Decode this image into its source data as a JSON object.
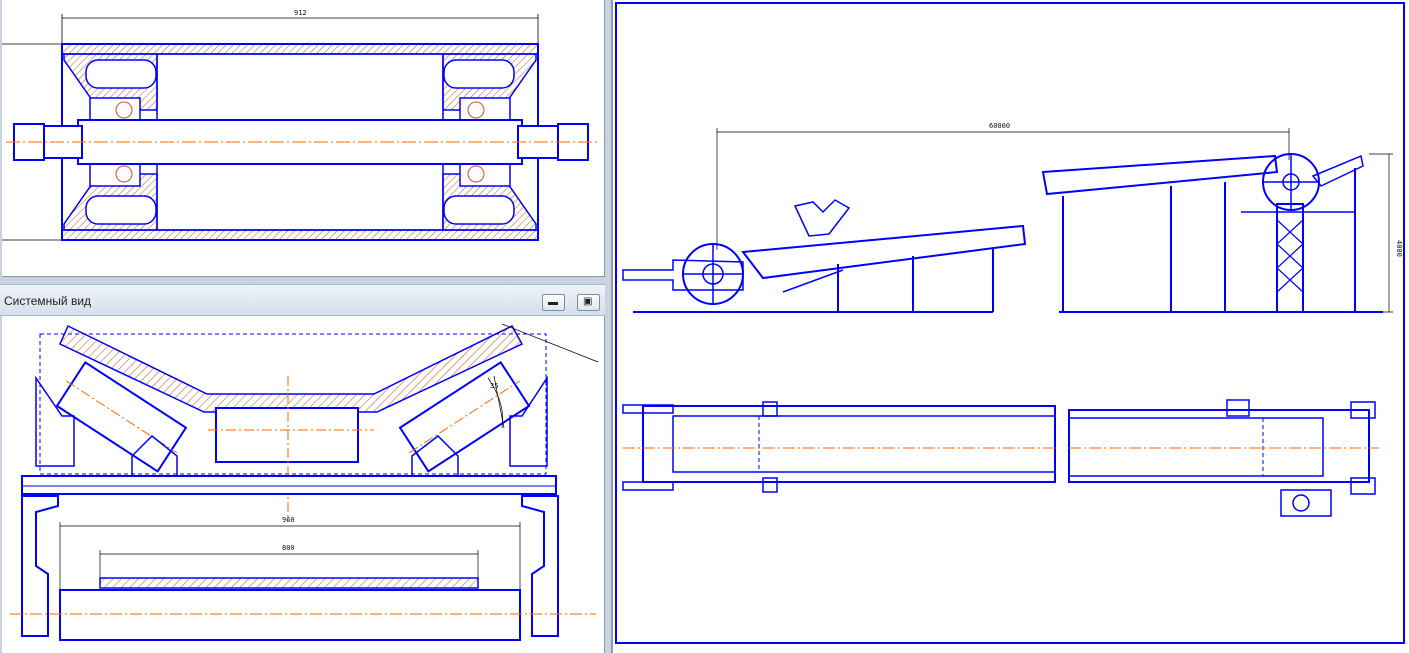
{
  "windows": {
    "bottom_left": {
      "title": "Системный вид",
      "minimize_icon": "minimize-icon",
      "restore_icon": "restore-icon"
    }
  },
  "drawings": {
    "roller_section": {
      "dim_length": "912"
    },
    "idler_view": {
      "dim_frame": "960",
      "dim_belt": "800",
      "dim_short": "35"
    },
    "conveyor_view": {
      "dim_length": "60000",
      "dim_height": "4000"
    }
  },
  "colors": {
    "line": "#0000ff",
    "axis": "#ff6a00",
    "hatch": "#d4541e",
    "dim": "#000000"
  }
}
